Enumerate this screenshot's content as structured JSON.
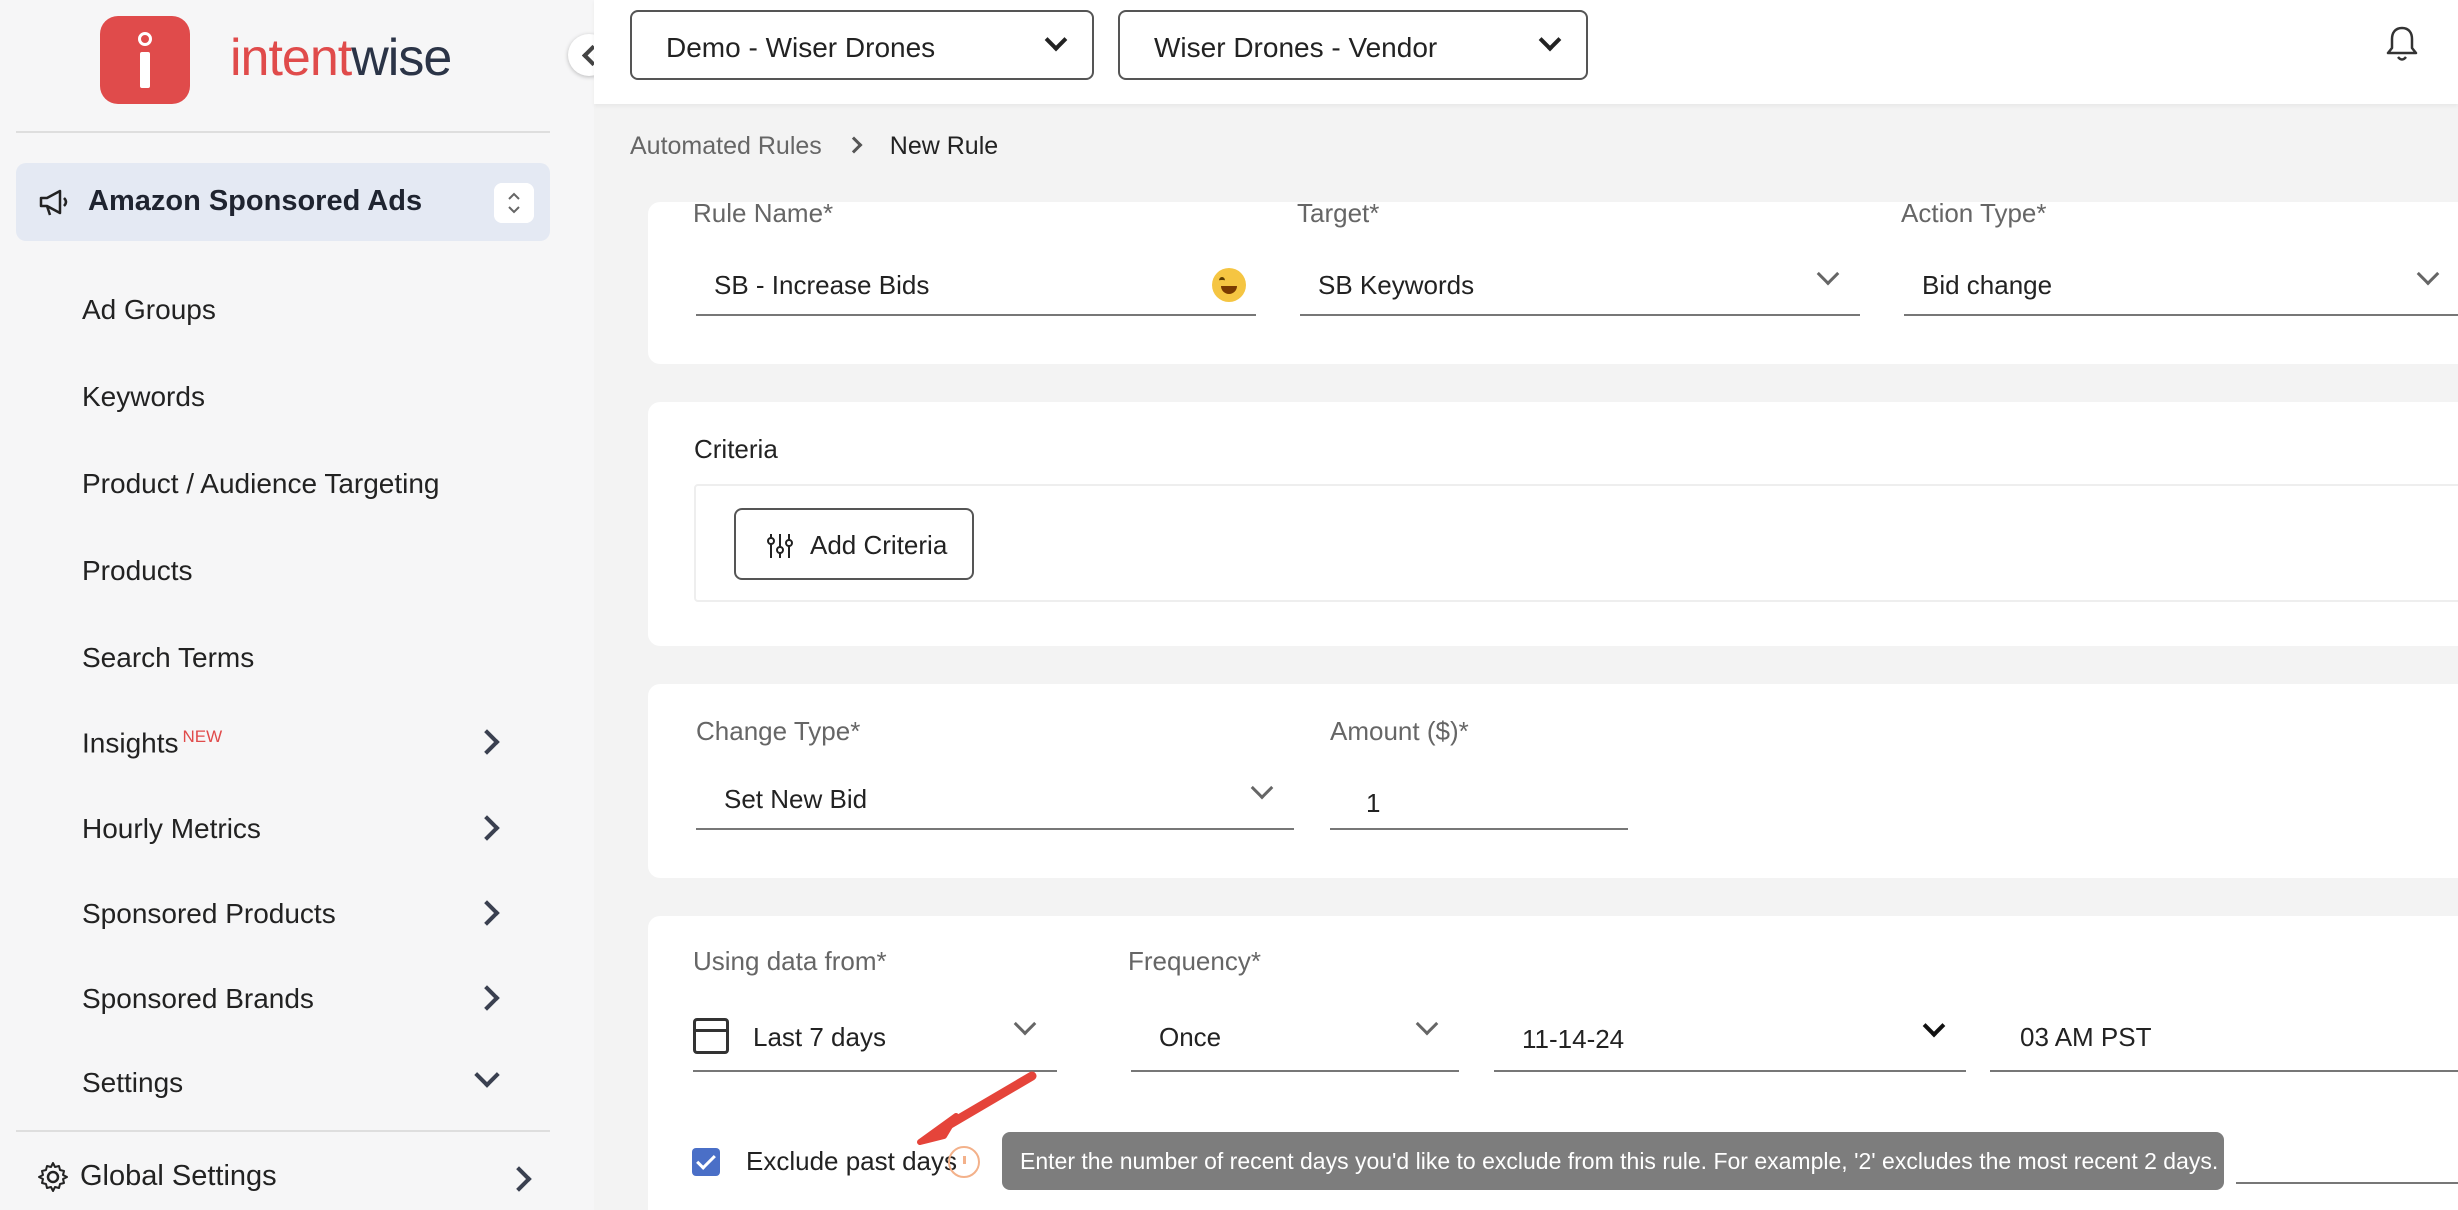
{
  "brand": {
    "name_part1": "intent",
    "name_part2": "wise"
  },
  "sidebar": {
    "product": "Amazon Sponsored Ads",
    "items": [
      {
        "label": "Ad Groups"
      },
      {
        "label": "Keywords"
      },
      {
        "label": "Product / Audience Targeting"
      },
      {
        "label": "Products"
      },
      {
        "label": "Search Terms"
      },
      {
        "label": "Insights",
        "badge": "NEW"
      },
      {
        "label": "Hourly Metrics"
      },
      {
        "label": "Sponsored Products"
      },
      {
        "label": "Sponsored Brands"
      },
      {
        "label": "Settings"
      }
    ],
    "global_settings": "Global Settings"
  },
  "topbar": {
    "account": "Demo - Wiser Drones",
    "profile": "Wiser Drones - Vendor"
  },
  "breadcrumb": {
    "parent": "Automated Rules",
    "current": "New Rule"
  },
  "rule": {
    "name_label": "Rule Name*",
    "name_value": "SB - Increase Bids",
    "target_label": "Target*",
    "target_value": "SB Keywords",
    "action_label": "Action Type*",
    "action_value": "Bid change"
  },
  "criteria": {
    "title": "Criteria",
    "add_button": "Add Criteria"
  },
  "change": {
    "type_label": "Change Type*",
    "type_value": "Set New Bid",
    "amount_label": "Amount ($)*",
    "amount_value": "1"
  },
  "schedule": {
    "data_label": "Using data from*",
    "data_value": "Last 7 days",
    "frequency_label": "Frequency*",
    "frequency_value": "Once",
    "date_value": "11-14-24",
    "time_value": "03 AM PST",
    "exclude_label": "Exclude past days",
    "tooltip": "Enter the number of recent days you'd like to exclude from this rule. For example, '2' excludes the most recent 2 days."
  },
  "colors": {
    "brand_red": "#e04b4b",
    "sidebar_active": "#e4e9f3",
    "checkbox": "#4a6fc7",
    "tooltip_bg": "#7d7d7d"
  }
}
